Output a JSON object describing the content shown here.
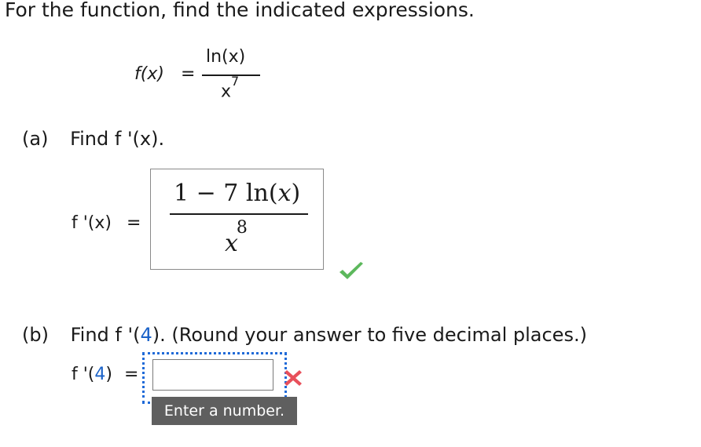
{
  "instruction": "For the function, find the indicated expressions.",
  "function": {
    "lhs": "f(x)",
    "equals": "=",
    "numerator": "ln(x)",
    "denominator_base": "x",
    "denominator_exp": "7"
  },
  "part_a": {
    "label": "(a)",
    "prompt": "Find f '(x).",
    "lhs": "f '(x)",
    "equals": "=",
    "answer": {
      "numerator": "1 − 7 ln",
      "numerator_arg": "(x)",
      "numerator_var": "x",
      "denominator_base": "x",
      "denominator_exp": "8"
    },
    "status": "correct",
    "status_icon": "check-icon",
    "status_color": "#5cb85c"
  },
  "part_b": {
    "label": "(b)",
    "prompt_start": "Find f '(",
    "prompt_value": "4",
    "prompt_end": "). (Round your answer to five decimal places.)",
    "lhs_start": "f '(",
    "lhs_value": "4",
    "lhs_end": ")",
    "equals": "=",
    "input_value": "",
    "tooltip": "Enter a number.",
    "status": "incorrect",
    "status_icon": "x-icon",
    "status_color": "#e8505b"
  },
  "colors": {
    "highlight_blue": "#1a62c8",
    "tooltip_bg": "#5f5f5f",
    "focus_outline": "#1f6ad8"
  }
}
